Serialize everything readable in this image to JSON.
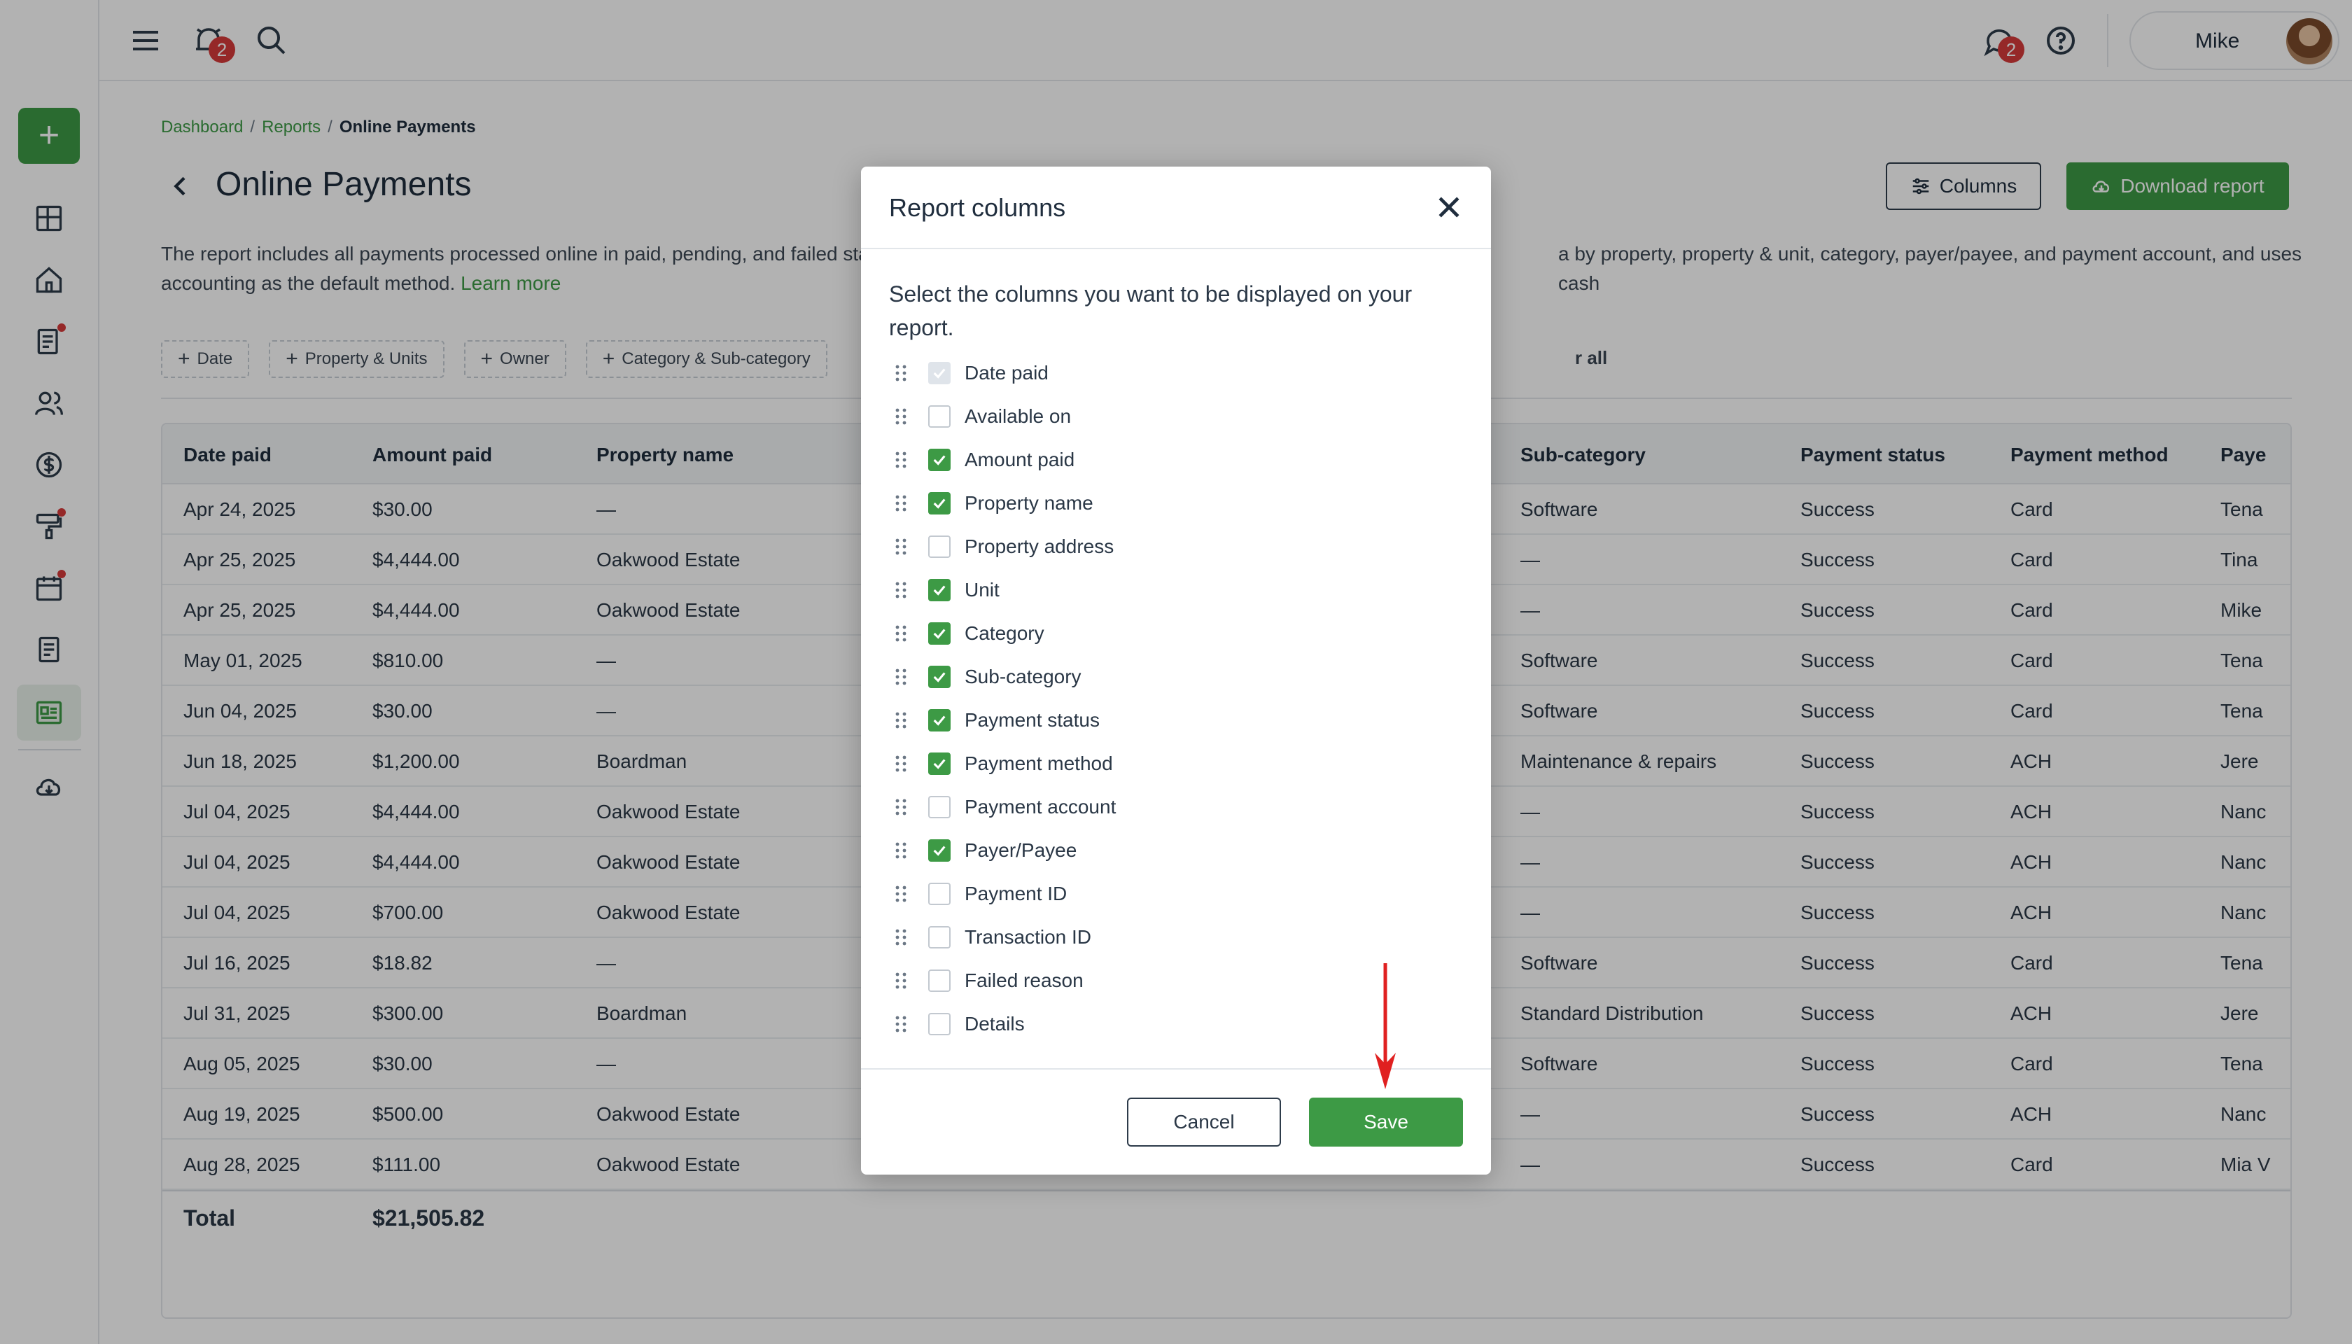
{
  "topbar": {
    "notifications_count": "2",
    "messages_count": "2",
    "user_name": "Mike"
  },
  "breadcrumb": {
    "items": [
      "Dashboard",
      "Reports"
    ],
    "current": "Online Payments",
    "separator": "/"
  },
  "page": {
    "title": "Online Payments",
    "columns_button": "Columns",
    "download_button": "Download report",
    "description_part1": "The report includes all payments processed online in paid, pending, and failed sta",
    "description_part2": "a by property, property & unit, category, payer/payee, and payment account, and uses cash",
    "description_line2": "accounting as the default method.",
    "learn_more": "Learn more"
  },
  "filters": {
    "chips": [
      "Date",
      "Property & Units",
      "Owner",
      "Category & Sub-category"
    ],
    "clear_all_fragment": "r all"
  },
  "table": {
    "headers": {
      "date_paid": "Date paid",
      "amount_paid": "Amount paid",
      "property_name": "Property name",
      "sub_category": "Sub-category",
      "payment_status": "Payment status",
      "payment_method": "Payment method",
      "payer_fragment": "Paye"
    },
    "rows": [
      {
        "date": "Apr 24, 2025",
        "amount": "$30.00",
        "property": "—",
        "subcat": "Software",
        "status": "Success",
        "method": "Card",
        "payer": "Tena"
      },
      {
        "date": "Apr 25, 2025",
        "amount": "$4,444.00",
        "property": "Oakwood Estate",
        "subcat": "—",
        "status": "Success",
        "method": "Card",
        "payer": "Tina"
      },
      {
        "date": "Apr 25, 2025",
        "amount": "$4,444.00",
        "property": "Oakwood Estate",
        "subcat": "—",
        "status": "Success",
        "method": "Card",
        "payer": "Mike"
      },
      {
        "date": "May 01, 2025",
        "amount": "$810.00",
        "property": "—",
        "subcat": "Software",
        "status": "Success",
        "method": "Card",
        "payer": "Tena"
      },
      {
        "date": "Jun 04, 2025",
        "amount": "$30.00",
        "property": "—",
        "subcat": "Software",
        "status": "Success",
        "method": "Card",
        "payer": "Tena"
      },
      {
        "date": "Jun 18, 2025",
        "amount": "$1,200.00",
        "property": "Boardman",
        "subcat": "Maintenance & repairs",
        "status": "Success",
        "method": "ACH",
        "payer": "Jere"
      },
      {
        "date": "Jul 04, 2025",
        "amount": "$4,444.00",
        "property": "Oakwood Estate",
        "subcat": "—",
        "status": "Success",
        "method": "ACH",
        "payer": "Nanc"
      },
      {
        "date": "Jul 04, 2025",
        "amount": "$4,444.00",
        "property": "Oakwood Estate",
        "subcat": "—",
        "status": "Success",
        "method": "ACH",
        "payer": "Nanc"
      },
      {
        "date": "Jul 04, 2025",
        "amount": "$700.00",
        "property": "Oakwood Estate",
        "subcat": "—",
        "status": "Success",
        "method": "ACH",
        "payer": "Nanc"
      },
      {
        "date": "Jul 16, 2025",
        "amount": "$18.82",
        "property": "—",
        "subcat": "Software",
        "status": "Success",
        "method": "Card",
        "payer": "Tena"
      },
      {
        "date": "Jul 31, 2025",
        "amount": "$300.00",
        "property": "Boardman",
        "subcat": "Standard Distribution",
        "status": "Success",
        "method": "ACH",
        "payer": "Jere"
      },
      {
        "date": "Aug 05, 2025",
        "amount": "$30.00",
        "property": "—",
        "subcat": "Software",
        "status": "Success",
        "method": "Card",
        "payer": "Tena"
      },
      {
        "date": "Aug 19, 2025",
        "amount": "$500.00",
        "property": "Oakwood Estate",
        "subcat": "—",
        "status": "Success",
        "method": "ACH",
        "payer": "Nanc"
      },
      {
        "date": "Aug 28, 2025",
        "amount": "$111.00",
        "property": "Oakwood Estate",
        "subcat": "—",
        "status": "Success",
        "method": "Card",
        "payer": "Mia V"
      }
    ],
    "total_label": "Total",
    "total_amount": "$21,505.82"
  },
  "modal": {
    "title": "Report columns",
    "description": "Select the columns you want to be displayed on your report.",
    "columns": [
      {
        "label": "Date paid",
        "state": "disabled"
      },
      {
        "label": "Available on",
        "state": "unchecked"
      },
      {
        "label": "Amount paid",
        "state": "checked"
      },
      {
        "label": "Property name",
        "state": "checked"
      },
      {
        "label": "Property address",
        "state": "unchecked"
      },
      {
        "label": "Unit",
        "state": "checked"
      },
      {
        "label": "Category",
        "state": "checked"
      },
      {
        "label": "Sub-category",
        "state": "checked"
      },
      {
        "label": "Payment status",
        "state": "checked"
      },
      {
        "label": "Payment method",
        "state": "checked"
      },
      {
        "label": "Payment account",
        "state": "unchecked"
      },
      {
        "label": "Payer/Payee",
        "state": "checked"
      },
      {
        "label": "Payment ID",
        "state": "unchecked"
      },
      {
        "label": "Transaction ID",
        "state": "unchecked"
      },
      {
        "label": "Failed reason",
        "state": "unchecked"
      },
      {
        "label": "Details",
        "state": "unchecked"
      }
    ],
    "cancel_label": "Cancel",
    "save_label": "Save"
  },
  "colors": {
    "brand_green": "#3d9a45",
    "badge_red": "#d63a3a",
    "annotation_arrow": "#e02020"
  }
}
